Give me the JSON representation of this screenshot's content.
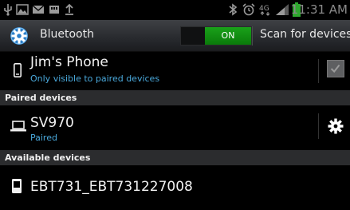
{
  "status_bar": {
    "time": "11:31 AM",
    "icons": [
      "usb-icon",
      "image-icon",
      "email-icon",
      "sd-card-icon",
      "upload-icon",
      "bluetooth-icon",
      "alarm-icon",
      "4g-icon",
      "signal-icon",
      "battery-icon"
    ]
  },
  "action_bar": {
    "title": "Bluetooth",
    "toggle_label": "ON",
    "scan_label": "Scan for devices",
    "accent_color": "#1aa11a"
  },
  "this_device": {
    "name": "Jim's Phone",
    "visibility": "Only visible to paired devices",
    "visible_checked": true
  },
  "sections": {
    "paired": "Paired devices",
    "available": "Available devices"
  },
  "paired_devices": [
    {
      "name": "SV970",
      "status": "Paired",
      "icon": "laptop-icon"
    }
  ],
  "available_devices": [
    {
      "name": "EBT731_EBT731227008",
      "icon": "phone-icon"
    }
  ]
}
